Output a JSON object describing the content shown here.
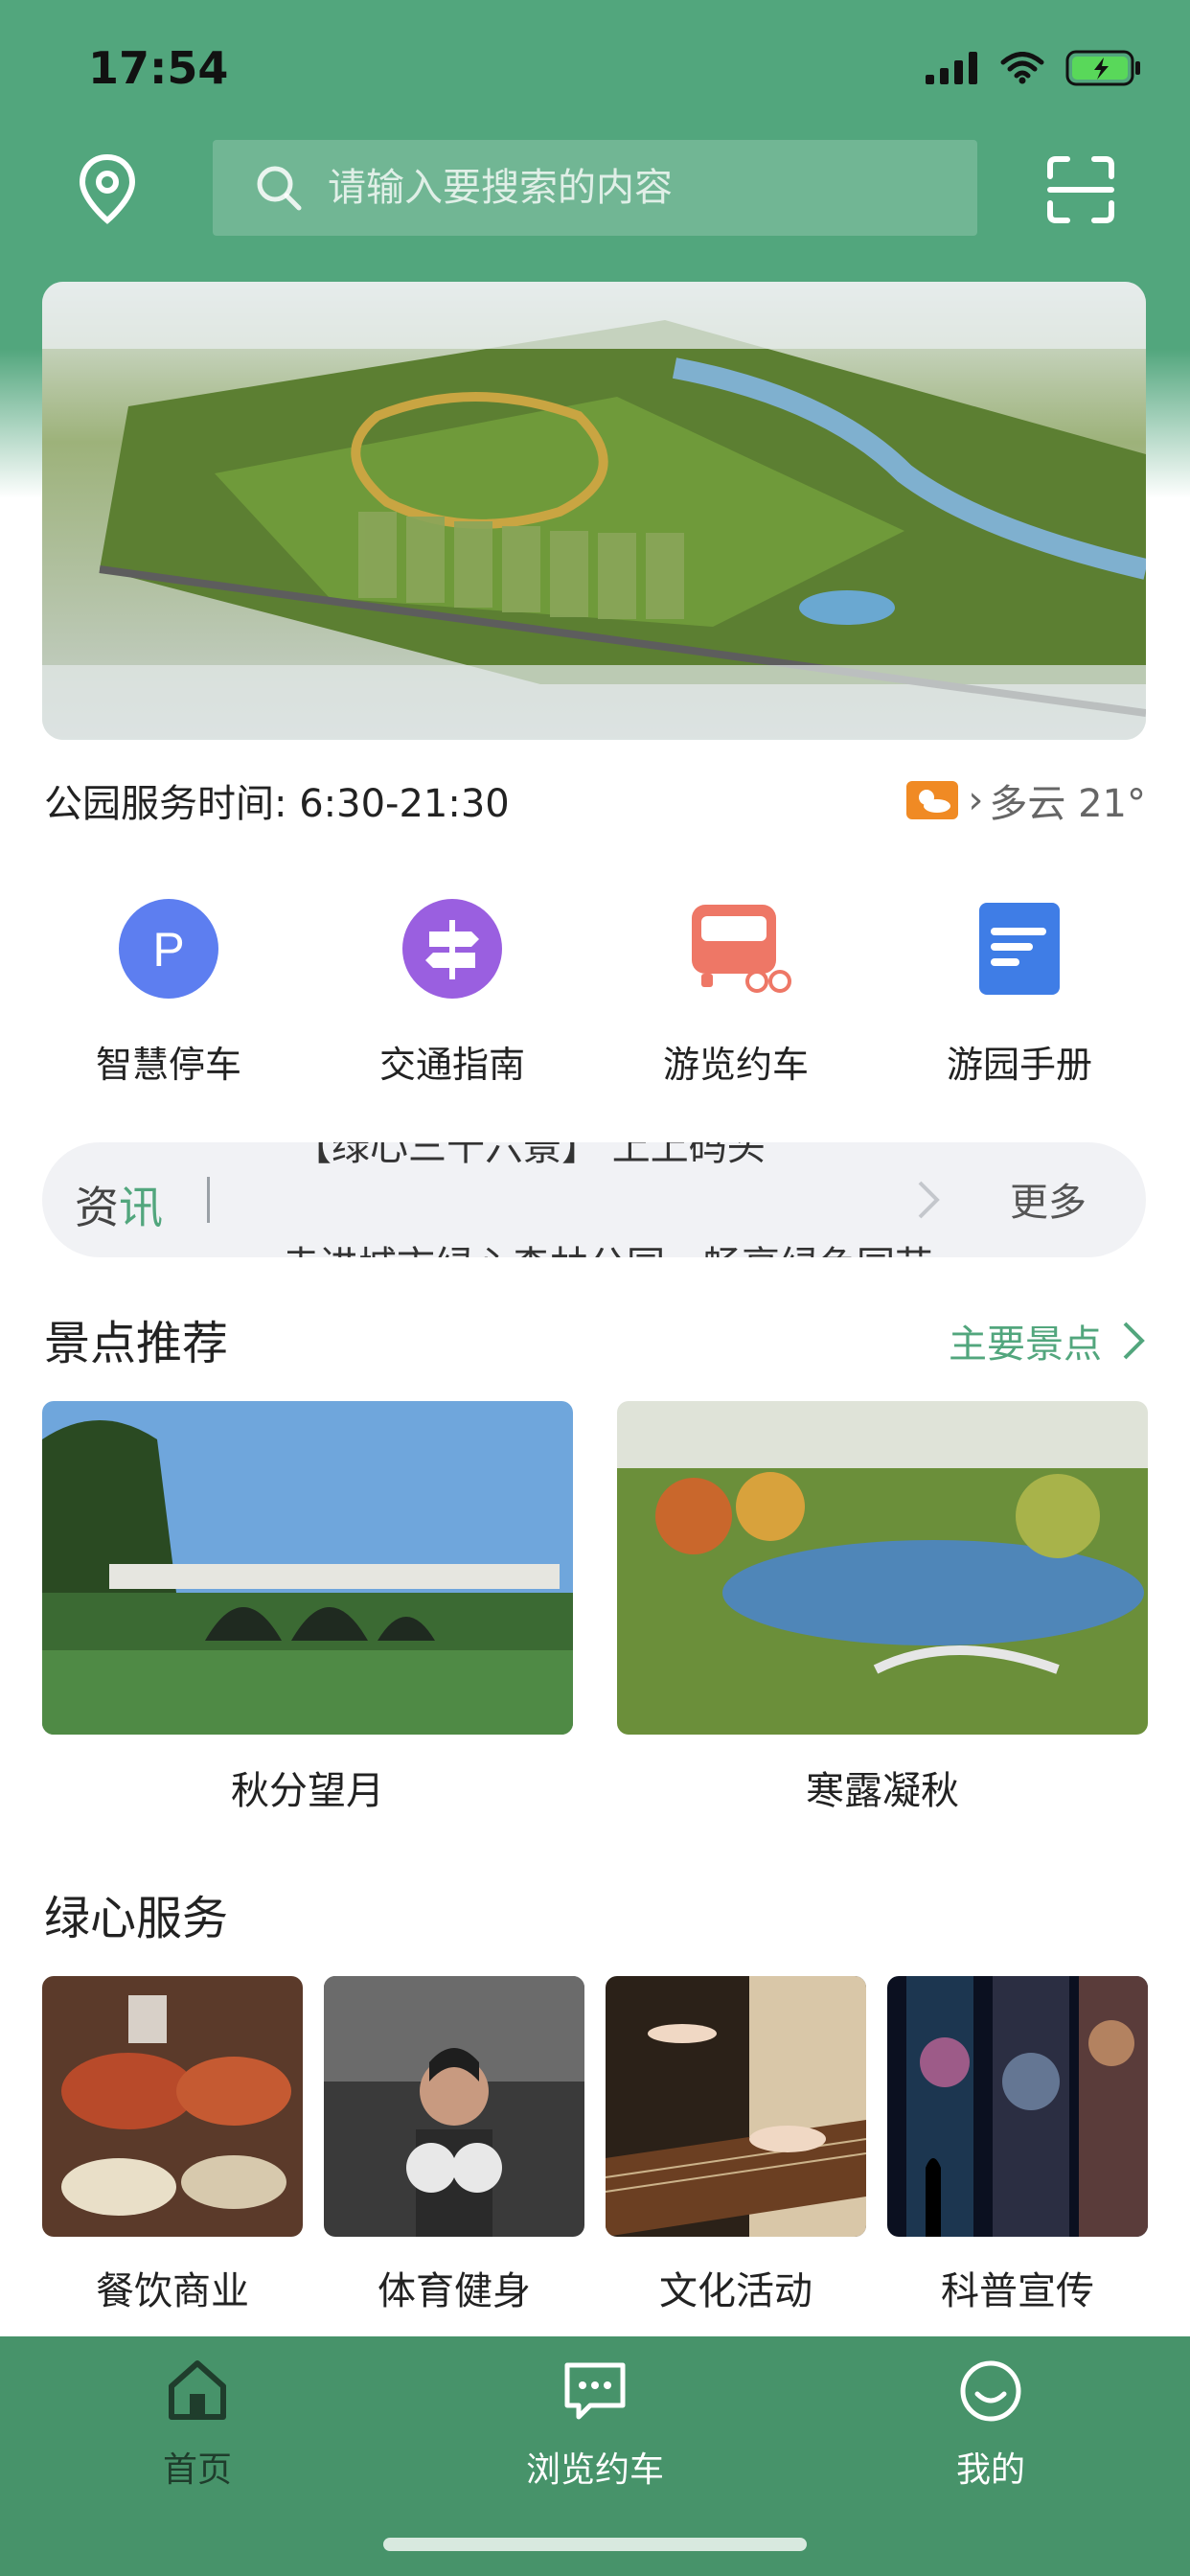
{
  "status_bar": {
    "time": "17:54"
  },
  "search": {
    "placeholder": "请输入要搜索的内容"
  },
  "info": {
    "service_time": "公园服务时间: 6:30-21:30",
    "weather": "多云 21°"
  },
  "quick_links": [
    {
      "label": "智慧停车",
      "icon": "parking-icon"
    },
    {
      "label": "交通指南",
      "icon": "signpost-icon"
    },
    {
      "label": "游览约车",
      "icon": "shuttle-bus-icon"
    },
    {
      "label": "游园手册",
      "icon": "handbook-icon"
    }
  ],
  "news": {
    "tag_a": "资",
    "tag_b": "讯",
    "line1": "【绿心三十六景】 上上码头",
    "line2": "走进城市绿心森林公园，畅享绿色园艺",
    "more": "更多"
  },
  "spots": {
    "title": "景点推荐",
    "link": "主要景点",
    "items": [
      {
        "label": "秋分望月"
      },
      {
        "label": "寒露凝秋"
      }
    ]
  },
  "services": {
    "title": "绿心服务",
    "items": [
      {
        "label": "餐饮商业"
      },
      {
        "label": "体育健身"
      },
      {
        "label": "文化活动"
      },
      {
        "label": "科普宣传"
      }
    ]
  },
  "tabs": [
    {
      "label": "首页",
      "active": true
    },
    {
      "label": "浏览约车",
      "active": false
    },
    {
      "label": "我的",
      "active": false
    }
  ],
  "colors": {
    "brand": "#52a67d",
    "tabbar": "#47936a",
    "active_tab": "#1f3d2c"
  }
}
